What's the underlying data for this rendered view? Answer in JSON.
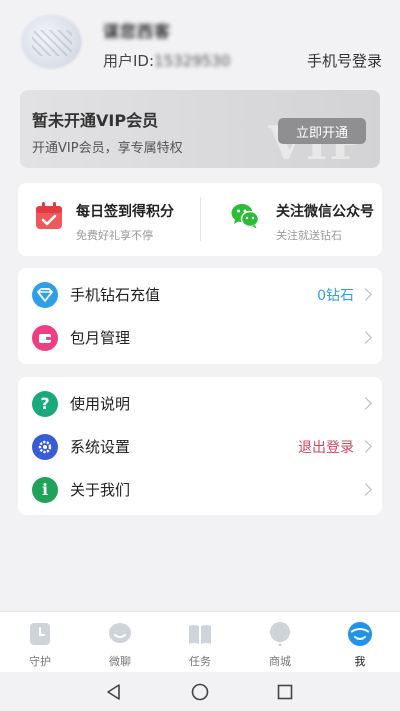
{
  "profile": {
    "nickname": "谋您西客",
    "uid_label": "用户ID:",
    "uid_value": "15329530",
    "phone_login": "手机号登录"
  },
  "vip": {
    "title": "暂未开通VIP会员",
    "subtitle": "开通VIP会员，享专属特权",
    "button": "立即开通",
    "watermark": "VIP"
  },
  "shortcuts": [
    {
      "title": "每日签到得积分",
      "subtitle": "免费好礼享不停",
      "icon": "calendar-icon"
    },
    {
      "title": "关注微信公众号",
      "subtitle": "关注就送钻石",
      "icon": "wechat-icon"
    }
  ],
  "menu1": [
    {
      "label": "手机钻石充值",
      "value": "0钻石",
      "icon": "diamond-icon",
      "color": "#2fa0e6",
      "value_color": "#2fa0e6"
    },
    {
      "label": "包月管理",
      "value": "",
      "icon": "wallet-icon",
      "color": "#ef3f84"
    }
  ],
  "menu2": [
    {
      "label": "使用说明",
      "value": "",
      "icon": "question-icon",
      "color": "#1aa97a"
    },
    {
      "label": "系统设置",
      "value": "退出登录",
      "icon": "gear-icon",
      "color": "#3a5bd6",
      "value_color": "#d9455f"
    },
    {
      "label": "关于我们",
      "value": "",
      "icon": "info-icon",
      "color": "#21a25a"
    }
  ],
  "tabs": [
    {
      "label": "守护",
      "icon": "clock-icon"
    },
    {
      "label": "微聊",
      "icon": "chat-icon"
    },
    {
      "label": "任务",
      "icon": "book-icon"
    },
    {
      "label": "商城",
      "icon": "balloon-icon"
    },
    {
      "label": "我",
      "icon": "profile-icon",
      "active": true
    }
  ],
  "colors": {
    "accent": "#1f94e8",
    "inactive_icon": "#cfd3da"
  }
}
